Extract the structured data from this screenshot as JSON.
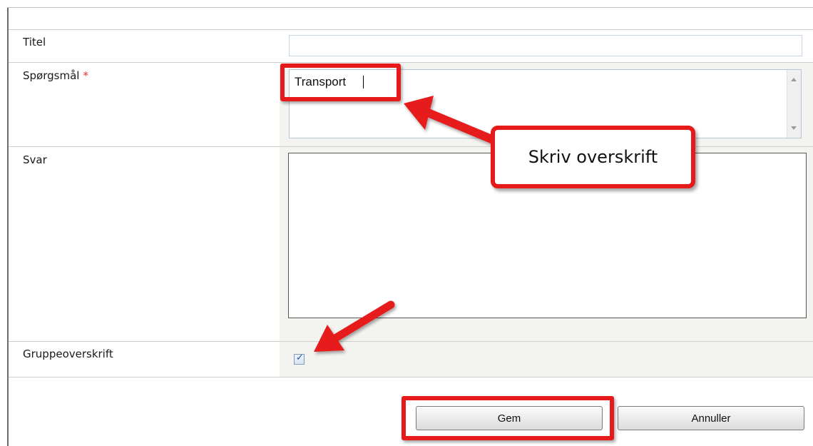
{
  "form": {
    "fields": {
      "titel": {
        "label": "Titel",
        "value": ""
      },
      "spoergsmaal": {
        "label": "Spørgsmål",
        "required_marker": "*",
        "value": "Transport"
      },
      "svar": {
        "label": "Svar",
        "value": ""
      },
      "gruppeoverskrift": {
        "label": "Gruppeoverskrift",
        "checked": true,
        "check_glyph": "✓"
      }
    },
    "buttons": {
      "save": "Gem",
      "cancel": "Annuller"
    }
  },
  "annotations": {
    "callout_text": "Skriv overskrift",
    "color": "#e61a1a"
  },
  "colors": {
    "field_shade": "#f3f3ef",
    "required": "#e03030"
  }
}
